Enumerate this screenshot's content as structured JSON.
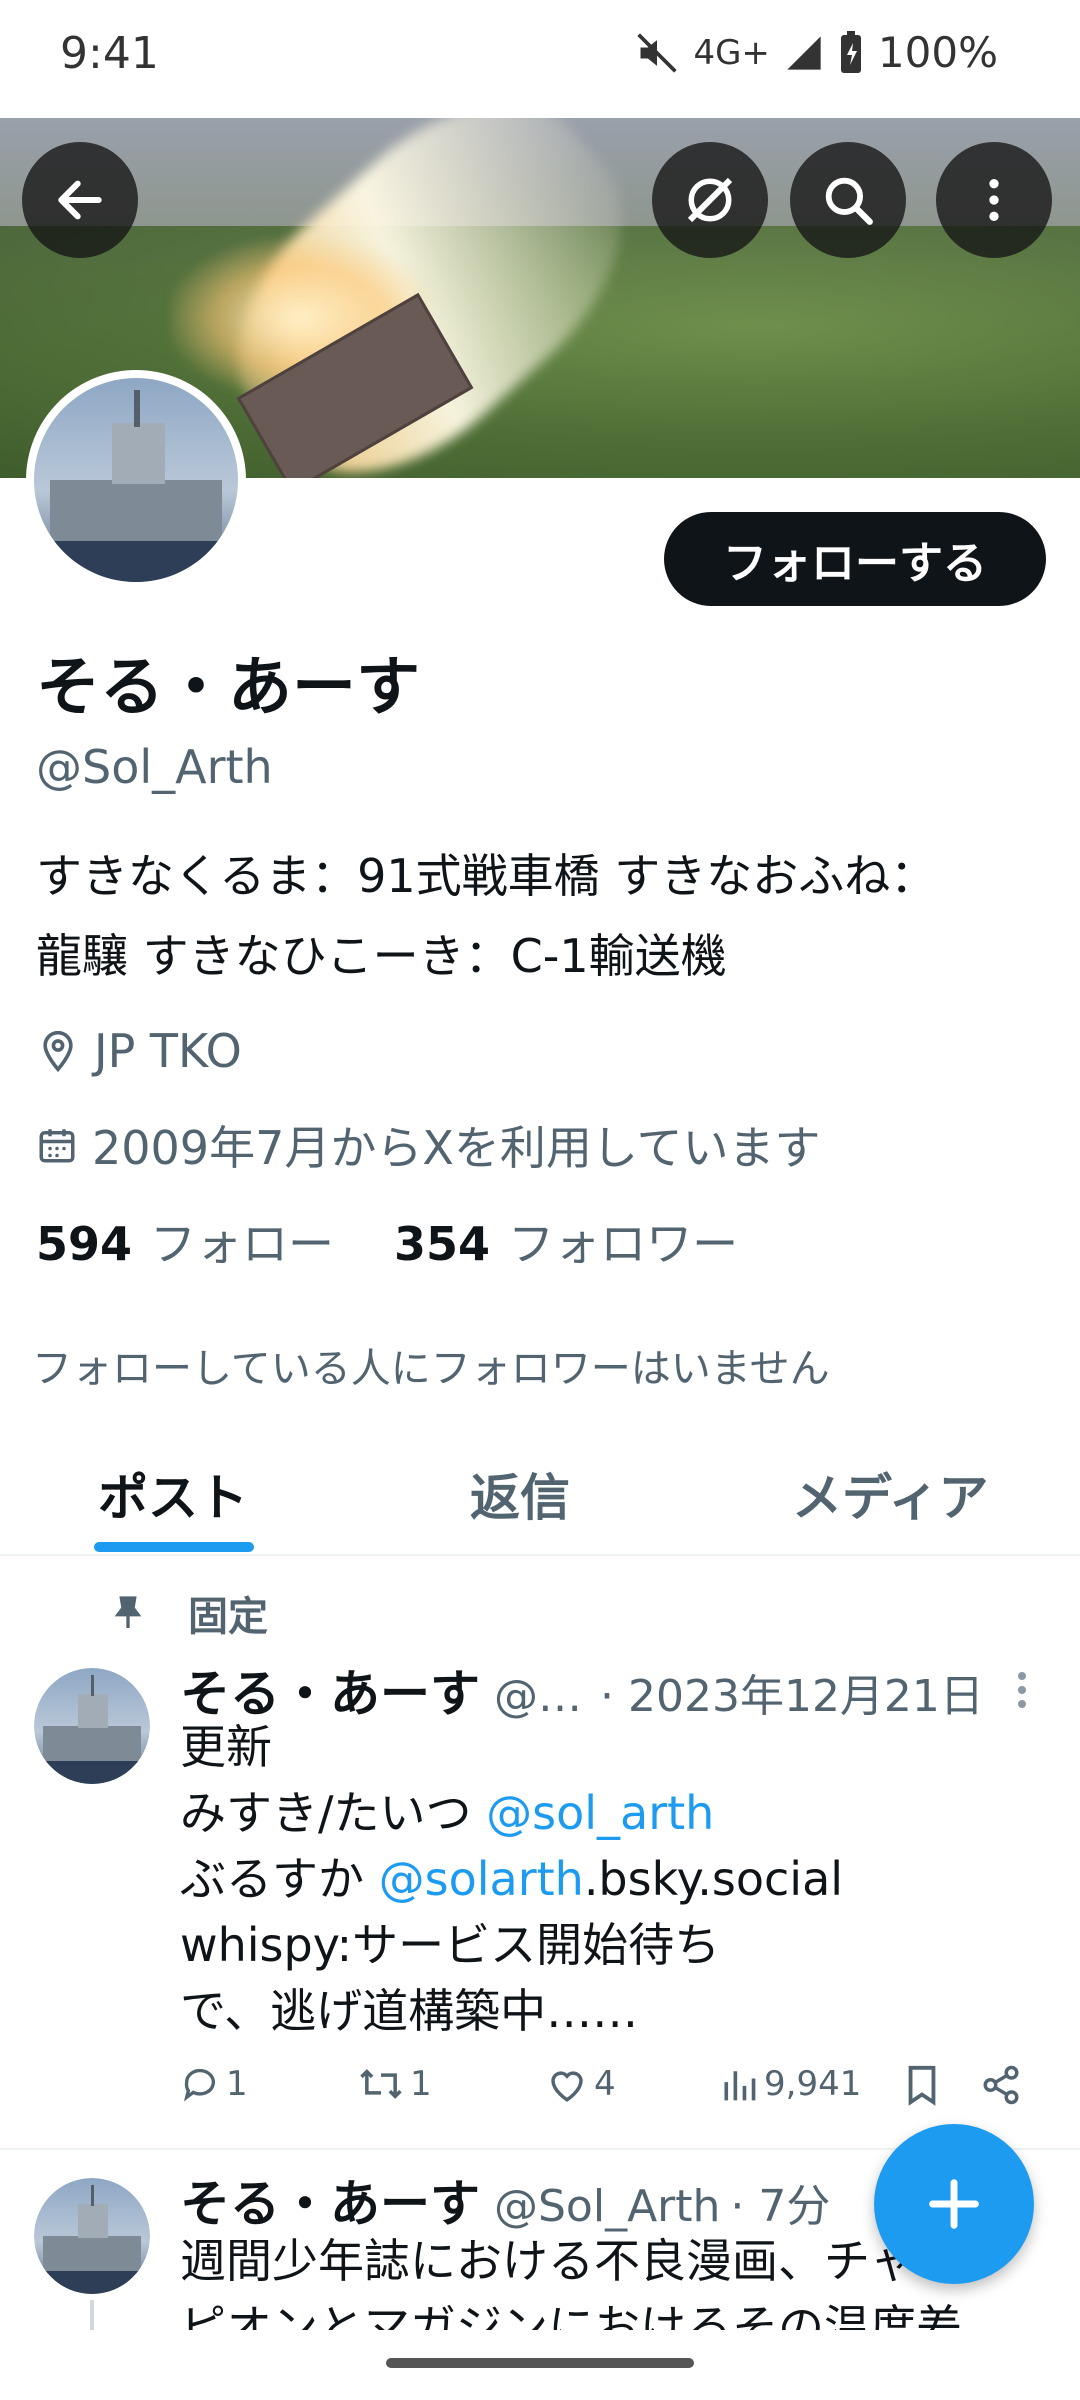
{
  "status_bar": {
    "time": "9:41",
    "network": "4G+",
    "battery": "100%"
  },
  "profile": {
    "display_name": "そる・あーす",
    "handle": "@Sol_Arth",
    "follow_label": "フォローする",
    "bio_line1": "すきなくるま：91式戦車橋 すきなおふね：",
    "bio_line2": "龍驤 すきなひこーき：C-1輸送機",
    "location": "JP TKO",
    "joined": "2009年7月からXを利用しています",
    "following_count": "594",
    "following_label": "フォロー",
    "followers_count": "354",
    "followers_label": "フォロワー",
    "followers_you_know": "フォローしている人にフォロワーはいません"
  },
  "tabs": [
    {
      "label": "ポスト",
      "active": true
    },
    {
      "label": "返信",
      "active": false
    },
    {
      "label": "メディア",
      "active": false
    }
  ],
  "pinned_post": {
    "pinned_label": "固定",
    "name": "そる・あーす",
    "handle": "@…",
    "date": "· 2023年12月21日",
    "lines": {
      "l1": "更新",
      "l2_pre": "みすき/たいつ ",
      "l2_mention": "@sol_arth",
      "l3_pre": "ぶるすか ",
      "l3_mention": "@solarth",
      "l3_post": ".bsky.social",
      "l4": "whispy:サービス開始待ち",
      "l5": "で、逃げ道構築中……"
    },
    "replies": "1",
    "reposts": "1",
    "likes": "4",
    "views": "9,941"
  },
  "second_post": {
    "name": "そる・あーす",
    "handle": "@Sol_Arth",
    "time": "· 7分",
    "line1": "週間少年誌における不良漫画、チャン",
    "line2": "ピオンとマガジンにおけるその温度差"
  },
  "colors": {
    "accent": "#1d9bf0",
    "text": "#0f1419",
    "muted": "#536471"
  }
}
